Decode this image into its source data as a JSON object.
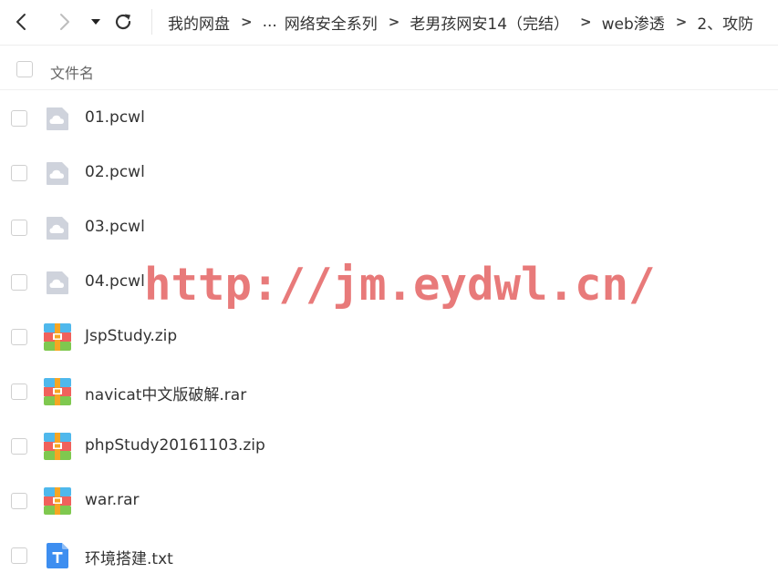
{
  "toolbar": {
    "back_icon": "chevron-left-icon",
    "forward_icon": "chevron-right-icon",
    "history_icon": "caret-down-icon",
    "refresh_icon": "refresh-icon"
  },
  "breadcrumb": {
    "separator": ">",
    "items": [
      "我的网盘",
      "...",
      "网络安全系列",
      "老男孩网安14（完结）",
      "web渗透",
      "2、攻防"
    ]
  },
  "list_header": {
    "name_label": "文件名"
  },
  "files": [
    {
      "name": "01.pcwl",
      "icon": "cloud-file-icon"
    },
    {
      "name": "02.pcwl",
      "icon": "cloud-file-icon"
    },
    {
      "name": "03.pcwl",
      "icon": "cloud-file-icon"
    },
    {
      "name": "04.pcwl",
      "icon": "cloud-file-icon"
    },
    {
      "name": "JspStudy.zip",
      "icon": "archive-icon"
    },
    {
      "name": "navicat中文版破解.rar",
      "icon": "archive-icon"
    },
    {
      "name": "phpStudy20161103.zip",
      "icon": "archive-icon"
    },
    {
      "name": "war.rar",
      "icon": "archive-icon"
    },
    {
      "name": "环境搭建.txt",
      "icon": "text-file-icon"
    }
  ],
  "watermark": {
    "text": "http://jm.eydwl.cn/",
    "color": "#e04848"
  },
  "colors": {
    "text": "#333333",
    "muted": "#666666",
    "divider": "#eeeeee",
    "archive_blue": "#4fb8ec",
    "archive_red": "#f0615b",
    "archive_green": "#7fc84f",
    "archive_orange": "#f5a623",
    "text_file_blue": "#3d8ef0",
    "cloud_file_gray": "#cfd3dc"
  }
}
